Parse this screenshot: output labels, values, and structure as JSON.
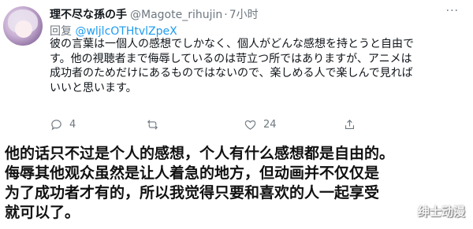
{
  "tweet": {
    "display_name": "理不尽な孫の手",
    "handle": "@Magote_rihujin",
    "time": "7小时",
    "reply_prefix": "回复",
    "reply_to": "@wljlcOTHtvlZpeX",
    "text_lines": [
      "彼の言葉は一個人の感想でしかなく、個人がどんな感想を持とうと自由で",
      "す。他の視聴者まで侮辱しているのは苛立つ所ではありますが、アニメは",
      "成功者のためだけにあるものではないので、楽しめる人で楽しんで見れば",
      "いいと思います。"
    ],
    "actions": {
      "reply_count": "4",
      "retweet_count": "",
      "like_count": "24"
    }
  },
  "caption": {
    "lines": [
      "他的话只不过是个人的感想，个人有什么感想都是自由的。",
      "侮辱其他观众虽然是让人着急的地方，但动画并不仅仅是",
      "为了成功者才有的，所以我觉得只要和喜欢的人一起享受",
      "就可以了。"
    ]
  },
  "watermark": "绅士动漫",
  "colors": {
    "link": "#1d9bf0",
    "secondary_text": "#6d7780",
    "primary_text": "#0f1419"
  },
  "icons": [
    "reply-icon",
    "retweet-icon",
    "like-icon",
    "share-icon",
    "more-icon"
  ]
}
